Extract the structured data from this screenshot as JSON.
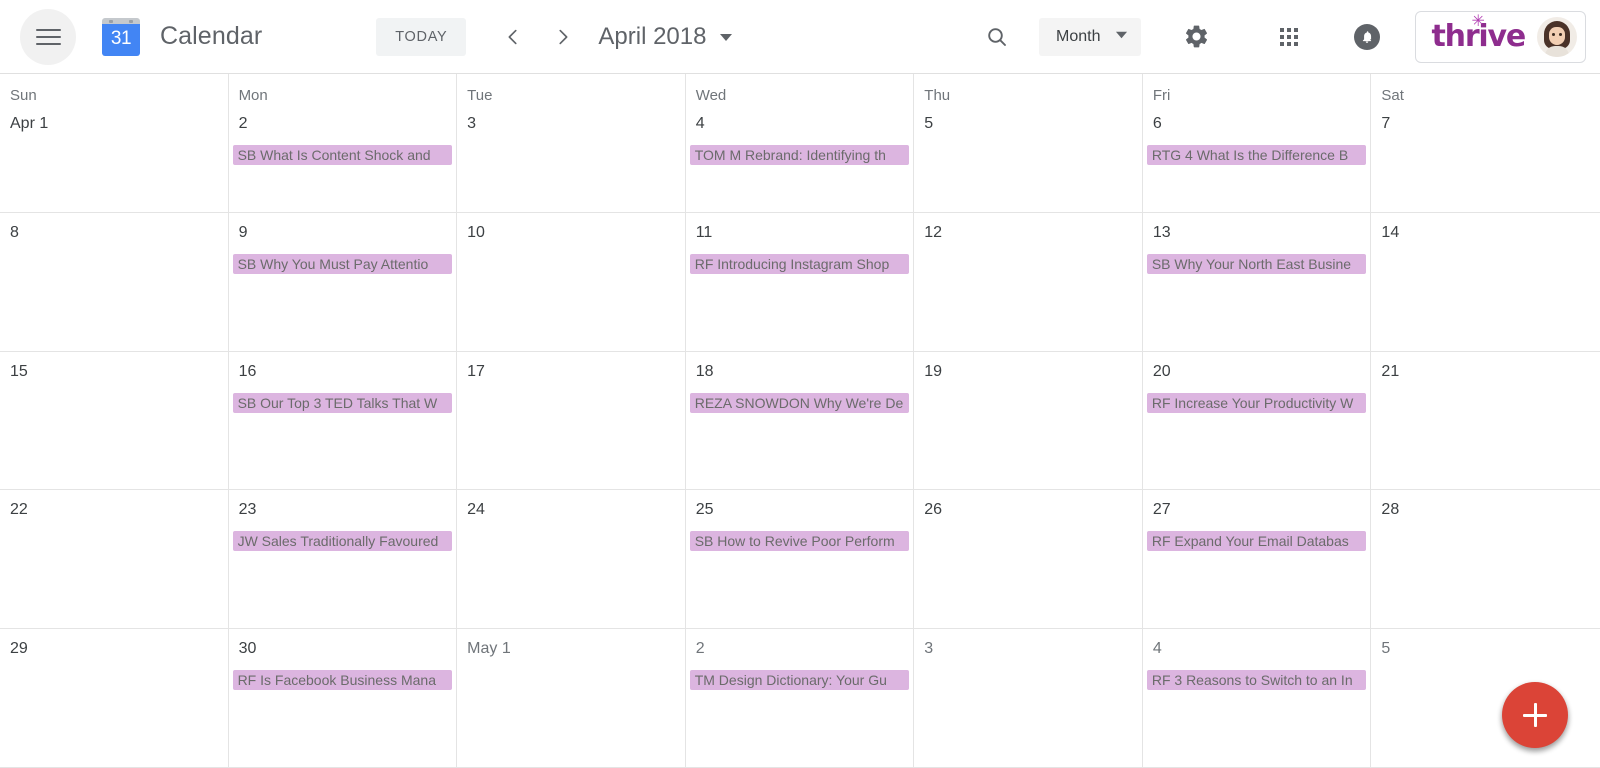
{
  "header": {
    "menu_icon": "hamburger-menu-icon",
    "logo_day": "31",
    "app_title": "Calendar",
    "today_label": "TODAY",
    "prev_icon": "chevron-left-icon",
    "next_icon": "chevron-right-icon",
    "period_label": "April 2018",
    "period_caret_icon": "chevron-down-icon",
    "search_icon": "search-icon",
    "view_label": "Month",
    "view_caret_icon": "chevron-down-icon",
    "settings_icon": "gear-icon",
    "apps_icon": "apps-grid-icon",
    "notifications_icon": "bell-icon",
    "brand_name": "thrive",
    "brand_color": "#8e2d8e",
    "avatar_icon": "user-avatar"
  },
  "calendar": {
    "event_color": "#dcb5e0",
    "event_text_color": "#6b6b6b",
    "fab": {
      "icon": "plus-icon",
      "color": "#db4437"
    },
    "weeks": [
      {
        "days": [
          {
            "dow": "Sun",
            "num": "Apr 1",
            "muted": false,
            "events": []
          },
          {
            "dow": "Mon",
            "num": "2",
            "muted": false,
            "events": [
              {
                "title": "SB What Is Content Shock and"
              }
            ]
          },
          {
            "dow": "Tue",
            "num": "3",
            "muted": false,
            "events": []
          },
          {
            "dow": "Wed",
            "num": "4",
            "muted": false,
            "events": [
              {
                "title": "TOM M Rebrand: Identifying th"
              }
            ]
          },
          {
            "dow": "Thu",
            "num": "5",
            "muted": false,
            "events": []
          },
          {
            "dow": "Fri",
            "num": "6",
            "muted": false,
            "events": [
              {
                "title": "RTG 4 What Is the Difference B"
              }
            ]
          },
          {
            "dow": "Sat",
            "num": "7",
            "muted": false,
            "events": []
          }
        ]
      },
      {
        "days": [
          {
            "dow": "",
            "num": "8",
            "muted": false,
            "events": []
          },
          {
            "dow": "",
            "num": "9",
            "muted": false,
            "events": [
              {
                "title": "SB Why You Must Pay Attentio"
              }
            ]
          },
          {
            "dow": "",
            "num": "10",
            "muted": false,
            "events": []
          },
          {
            "dow": "",
            "num": "11",
            "muted": false,
            "events": [
              {
                "title": "RF Introducing Instagram Shop"
              }
            ]
          },
          {
            "dow": "",
            "num": "12",
            "muted": false,
            "events": []
          },
          {
            "dow": "",
            "num": "13",
            "muted": false,
            "events": [
              {
                "title": "SB Why Your North East Busine"
              }
            ]
          },
          {
            "dow": "",
            "num": "14",
            "muted": false,
            "events": []
          }
        ]
      },
      {
        "days": [
          {
            "dow": "",
            "num": "15",
            "muted": false,
            "events": []
          },
          {
            "dow": "",
            "num": "16",
            "muted": false,
            "events": [
              {
                "title": "SB Our Top 3 TED Talks That W"
              }
            ]
          },
          {
            "dow": "",
            "num": "17",
            "muted": false,
            "events": []
          },
          {
            "dow": "",
            "num": "18",
            "muted": false,
            "events": [
              {
                "title": "REZA SNOWDON Why We're De"
              }
            ]
          },
          {
            "dow": "",
            "num": "19",
            "muted": false,
            "events": []
          },
          {
            "dow": "",
            "num": "20",
            "muted": false,
            "events": [
              {
                "title": "RF Increase Your Productivity W"
              }
            ]
          },
          {
            "dow": "",
            "num": "21",
            "muted": false,
            "events": []
          }
        ]
      },
      {
        "days": [
          {
            "dow": "",
            "num": "22",
            "muted": false,
            "events": []
          },
          {
            "dow": "",
            "num": "23",
            "muted": false,
            "events": [
              {
                "title": "JW Sales Traditionally Favoured"
              }
            ]
          },
          {
            "dow": "",
            "num": "24",
            "muted": false,
            "events": []
          },
          {
            "dow": "",
            "num": "25",
            "muted": false,
            "events": [
              {
                "title": "SB How to Revive Poor Perform"
              }
            ]
          },
          {
            "dow": "",
            "num": "26",
            "muted": false,
            "events": []
          },
          {
            "dow": "",
            "num": "27",
            "muted": false,
            "events": [
              {
                "title": "RF Expand Your Email Databas"
              }
            ]
          },
          {
            "dow": "",
            "num": "28",
            "muted": false,
            "events": []
          }
        ]
      },
      {
        "days": [
          {
            "dow": "",
            "num": "29",
            "muted": false,
            "events": []
          },
          {
            "dow": "",
            "num": "30",
            "muted": false,
            "events": [
              {
                "title": "RF Is Facebook Business Mana"
              }
            ]
          },
          {
            "dow": "",
            "num": "May 1",
            "muted": true,
            "events": []
          },
          {
            "dow": "",
            "num": "2",
            "muted": true,
            "events": [
              {
                "title": "TM Design Dictionary: Your Gu"
              }
            ]
          },
          {
            "dow": "",
            "num": "3",
            "muted": true,
            "events": []
          },
          {
            "dow": "",
            "num": "4",
            "muted": true,
            "events": [
              {
                "title": "RF 3 Reasons to Switch to an In"
              }
            ]
          },
          {
            "dow": "",
            "num": "5",
            "muted": true,
            "events": []
          }
        ]
      }
    ]
  }
}
